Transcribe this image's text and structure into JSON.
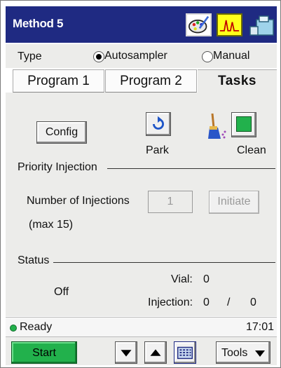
{
  "header": {
    "title": "Method 5",
    "icons": [
      "palette-icon",
      "chromatogram-icon",
      "instrument-icon"
    ]
  },
  "type_row": {
    "label": "Type",
    "options": [
      {
        "label": "Autosampler",
        "selected": true
      },
      {
        "label": "Manual",
        "selected": false
      }
    ]
  },
  "tabs": [
    {
      "label": "Program 1",
      "active": false
    },
    {
      "label": "Program 2",
      "active": false
    },
    {
      "label": "Tasks",
      "active": true
    }
  ],
  "tasks": {
    "config_label": "Config",
    "park_label": "Park",
    "clean_label": "Clean",
    "priority_injection": {
      "heading": "Priority Injection",
      "injections_label": "Number of Injections",
      "max_label": "(max 15)",
      "injections_value": "1",
      "initiate_label": "Initiate"
    },
    "status": {
      "heading": "Status",
      "state": "Off",
      "vial_label": "Vial:",
      "vial_value": "0",
      "injection_label": "Injection:",
      "injection_current": "0",
      "injection_separator": "/",
      "injection_total": "0"
    }
  },
  "status_bar": {
    "status": "Ready",
    "time": "17:01",
    "led_color": "#22b14c"
  },
  "toolbar": {
    "start_label": "Start",
    "tools_label": "Tools",
    "start_color": "#22b14c"
  },
  "colors": {
    "title_bar": "#1f2a82",
    "panel": "#ececea"
  }
}
